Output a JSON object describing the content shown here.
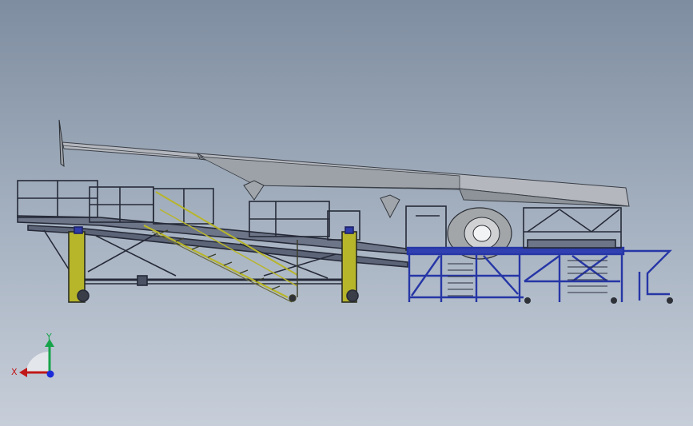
{
  "scene": {
    "background_top": "#7e8da0",
    "background_bottom": "#c7ced9",
    "wing_color": "#b9bdc2",
    "frame_color": "#2d3348",
    "blue_frame_color": "#2636a6",
    "yellow_color": "#b7b52a",
    "engine_color": "#a4a7aa"
  },
  "triad": {
    "y_label": "Y",
    "x_label": "X",
    "y_color": "#17a34a",
    "x_color": "#c01818",
    "z_color": "#1b2bd8"
  }
}
